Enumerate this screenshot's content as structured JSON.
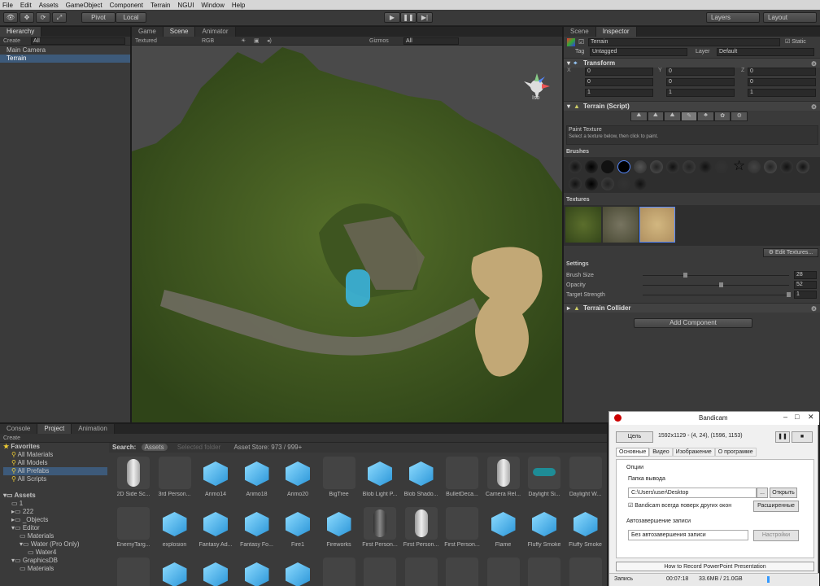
{
  "menu": [
    "File",
    "Edit",
    "Assets",
    "GameObject",
    "Component",
    "Terrain",
    "NGUI",
    "Window",
    "Help"
  ],
  "toolbar": {
    "pivot": "Pivot",
    "local": "Local",
    "layers": "Layers",
    "layout": "Layout"
  },
  "hierarchy": {
    "tab": "Hierarchy",
    "create": "Create",
    "search": "All",
    "items": [
      "Main Camera",
      "Terrain"
    ]
  },
  "scene": {
    "tabs": [
      "Game",
      "Scene",
      "Animator"
    ],
    "shading": "Textured",
    "rgb": "RGB",
    "gizmos": "Gizmos",
    "search": "All",
    "iso": "Iso"
  },
  "inspector": {
    "tabs": [
      "Scene",
      "Inspector"
    ],
    "name": "Terrain",
    "static": "Static",
    "tag_label": "Tag",
    "tag": "Untagged",
    "layer_label": "Layer",
    "layer": "Default",
    "transform": "Transform",
    "rows": [
      {
        "vals": [
          "0",
          "0",
          "0"
        ]
      },
      {
        "vals": [
          "0",
          "0",
          "0"
        ]
      },
      {
        "vals": [
          "1",
          "1",
          "1"
        ]
      }
    ],
    "axes": [
      "X",
      "Y",
      "Z"
    ],
    "terrain_script": "Terrain (Script)",
    "paint_title": "Paint Texture",
    "paint_desc": "Select a texture below, then click to paint.",
    "brushes": "Brushes",
    "textures": "Textures",
    "edit_textures": "Edit Textures...",
    "settings": "Settings",
    "settings_rows": [
      {
        "label": "Brush Size",
        "value": "28"
      },
      {
        "label": "Opacity",
        "value": "52"
      },
      {
        "label": "Target Strength",
        "value": "1"
      }
    ],
    "collider": "Terrain Collider",
    "add_component": "Add Component"
  },
  "bottom": {
    "tabs": [
      "Console",
      "Project",
      "Animation"
    ],
    "create": "Create",
    "search_label": "Search:",
    "assets_chip": "Assets",
    "selected_folder": "Selected folder",
    "asset_store": "Asset Store: 973 / 999+",
    "favorites": "Favorites",
    "fav_items": [
      "All Materials",
      "All Models",
      "All Prefabs",
      "All Scripts"
    ],
    "assets_root": "Assets",
    "tree": [
      "1",
      "222",
      "_Objects",
      "Editor",
      "Materials",
      "Water (Pro Only)",
      "Water4",
      "GraphicsDB",
      "Materials"
    ],
    "row1": [
      "2D Side Sc...",
      "3rd Person...",
      "Arimo14",
      "Arimo18",
      "Arimo20",
      "BigTree",
      "Blob Light P...",
      "Blob Shado...",
      "BulletDeca...",
      "Camera Rel...",
      "Daylight Si...",
      "Daylight W..."
    ],
    "row2": [
      "EnemyTarg...",
      "explosion",
      "Fantasy Ad...",
      "Fantasy Fo...",
      "Fire1",
      "Fireworks",
      "First Person...",
      "First Person...",
      "First Person...",
      "Flame",
      "Fluffy Smoke",
      "Fluffy Smoke"
    ]
  },
  "bandicam": {
    "title": "Bandicam",
    "tab_target": "Цель",
    "resolution": "1592x1129 - (4, 24), (1596, 1153)",
    "tabs": [
      "Основные",
      "Видео",
      "Изображение",
      "О программе"
    ],
    "options": "Опции",
    "folder_label": "Папка вывода",
    "folder": "C:\\Users\\user\\Desktop",
    "dots": "...",
    "open": "Открыть",
    "always_top": "Bandicam всегда поверх других окон",
    "advanced": "Расширенные",
    "auto_label": "Автозавершение записи",
    "auto_value": "Без автозавершения записи",
    "settings_btn": "Настройки",
    "link": "How to Record PowerPoint Presentation",
    "status": "Запись",
    "time": "00:07:18",
    "size": "33.6MB / 21.0GB"
  }
}
